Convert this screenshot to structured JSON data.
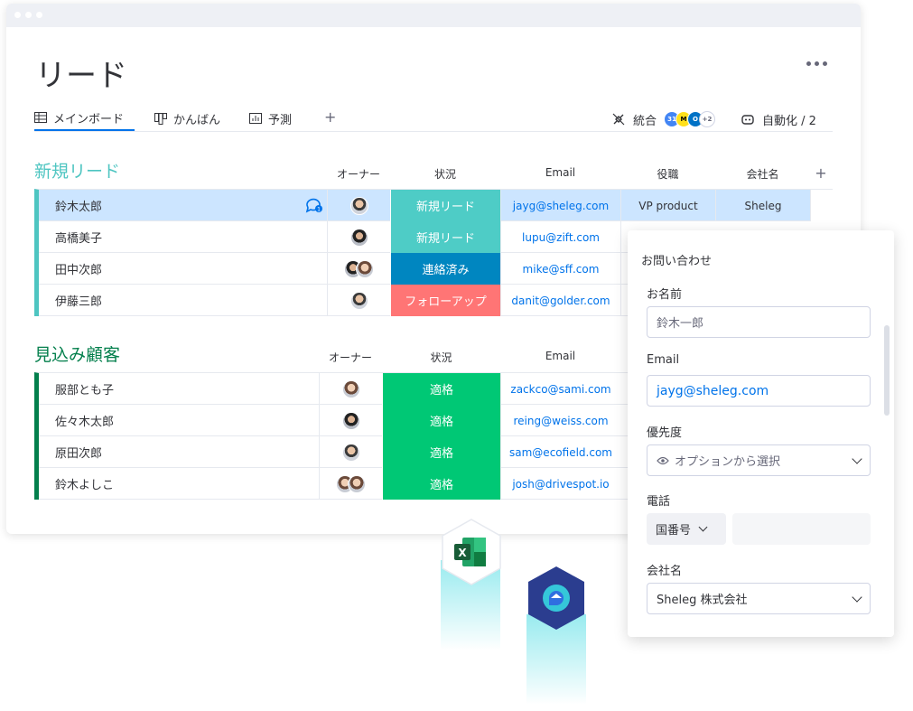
{
  "board": {
    "title": "リード",
    "tabs": [
      {
        "label": "メインボード",
        "icon": "table-icon",
        "active": true
      },
      {
        "label": "かんばん",
        "icon": "kanban-icon",
        "active": false
      },
      {
        "label": "予測",
        "icon": "chart-icon",
        "active": false
      }
    ],
    "add_tab": "+",
    "integrations_label": "統合",
    "integrations_more": "+2",
    "automations_label": "自動化 / 2"
  },
  "groups": [
    {
      "title": "新規リード",
      "color": "#4ec5c1",
      "columns": [
        "オーナー",
        "状況",
        "Email",
        "役職",
        "会社名",
        "+"
      ],
      "rows": [
        {
          "name": "鈴木太郎",
          "status": "新規リード",
          "status_color": "#4eccc6",
          "email": "jayg@sheleg.com",
          "role": "VP product",
          "company": "Sheleg"
        },
        {
          "name": "高橋美子",
          "status": "新規リード",
          "status_color": "#4eccc6",
          "email": "lupu@zift.com",
          "role": "",
          "company": ""
        },
        {
          "name": "田中次郎",
          "status": "連絡済み",
          "status_color": "#0086c0",
          "email": "mike@sff.com",
          "role": "",
          "company": ""
        },
        {
          "name": "伊藤三郎",
          "status": "フォローアップ",
          "status_color": "#ff7575",
          "email": "danit@golder.com",
          "role": "",
          "company": ""
        }
      ]
    },
    {
      "title": "見込み顧客",
      "color": "#037f4c",
      "columns": [
        "オーナー",
        "状況",
        "Email"
      ],
      "rows": [
        {
          "name": "服部とも子",
          "status": "適格",
          "status_color": "#00c875",
          "email": "zackco@sami.com"
        },
        {
          "name": "佐々木太郎",
          "status": "適格",
          "status_color": "#00c875",
          "email": "reing@weiss.com"
        },
        {
          "name": "原田次郎",
          "status": "適格",
          "status_color": "#00c875",
          "email": "sam@ecofield.com"
        },
        {
          "name": "鈴木よしこ",
          "status": "適格",
          "status_color": "#00c875",
          "email": "josh@drivespot.io"
        }
      ]
    }
  ],
  "form": {
    "title": "お問い合わせ",
    "name_label": "お名前",
    "name_value": "鈴木一郎",
    "email_label": "Email",
    "email_value": "jayg@sheleg.com",
    "priority_label": "優先度",
    "priority_placeholder": "オプションから選択",
    "phone_label": "電話",
    "country_code": "国番号",
    "company_label": "会社名",
    "company_value": "Sheleg 株式会社"
  },
  "colors": {
    "accent": "#0073ea",
    "selected_row": "#cce5ff",
    "excel": "#1d6f42",
    "glow": "#86e7ec"
  }
}
